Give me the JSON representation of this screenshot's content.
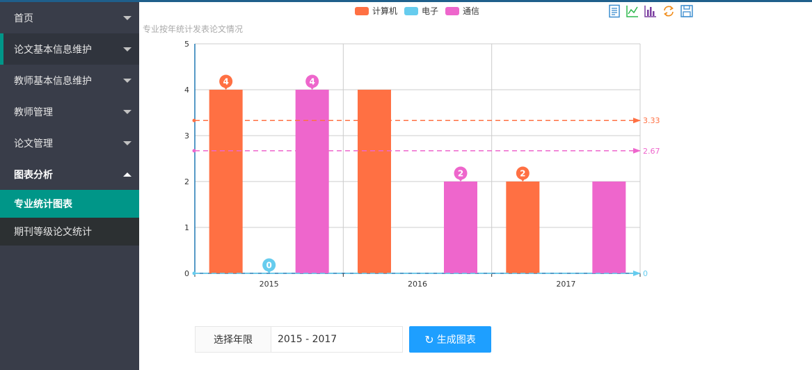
{
  "sidebar": {
    "items": [
      {
        "label": "首页"
      },
      {
        "label": "论文基本信息维护"
      },
      {
        "label": "教师基本信息维护"
      },
      {
        "label": "教师管理"
      },
      {
        "label": "论文管理"
      },
      {
        "label": "图表分析"
      }
    ],
    "subitems": [
      {
        "label": "专业统计图表"
      },
      {
        "label": "期刊等级论文统计"
      }
    ]
  },
  "chart_title": "专业按年统计发表论文情况",
  "toolbox_icons": [
    "data-view-icon",
    "line-chart-icon",
    "bar-chart-icon",
    "restore-icon",
    "save-image-icon"
  ],
  "colors": {
    "computer": "#ff7043",
    "electronics": "#66ccee",
    "telecom": "#ee66cc",
    "accent": "#009688",
    "button": "#1e9fff"
  },
  "chart_data": {
    "type": "bar",
    "categories": [
      "2015",
      "2016",
      "2017"
    ],
    "series": [
      {
        "name": "计算机",
        "values": [
          4,
          4,
          2
        ],
        "color": "#ff7043"
      },
      {
        "name": "电子",
        "values": [
          0,
          0,
          0
        ],
        "color": "#66ccee"
      },
      {
        "name": "通信",
        "values": [
          4,
          2,
          2
        ],
        "color": "#ee66cc"
      }
    ],
    "ylim": [
      0,
      5
    ],
    "yticks": [
      "0",
      "1",
      "2",
      "3",
      "4",
      "5"
    ],
    "mark_points": [
      {
        "series": 0,
        "category": 0,
        "label": "4"
      },
      {
        "series": 0,
        "category": 2,
        "label": "2"
      },
      {
        "series": 1,
        "category": 0,
        "label": "0"
      },
      {
        "series": 2,
        "category": 0,
        "label": "4"
      },
      {
        "series": 2,
        "category": 1,
        "label": "2"
      }
    ],
    "mark_lines": [
      {
        "series": 0,
        "value": 3.33,
        "label": "3.33"
      },
      {
        "series": 2,
        "value": 2.67,
        "label": "2.67"
      },
      {
        "series": 1,
        "value": 0,
        "label": "0"
      }
    ],
    "grid": true,
    "legend_position": "top-center"
  },
  "filter": {
    "label": "选择年限",
    "value": "2015 - 2017",
    "button": "生成图表"
  }
}
